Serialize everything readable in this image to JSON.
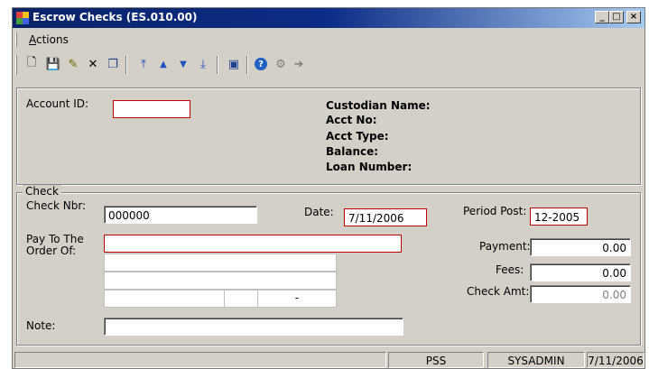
{
  "window": {
    "title": "Escrow Checks (ES.010.00)"
  },
  "menu": {
    "actions_label": "Actions"
  },
  "toolbar": {
    "buttons": [
      {
        "name": "new-icon",
        "glyph": "🗋"
      },
      {
        "name": "save-icon",
        "glyph": "💾"
      },
      {
        "name": "edit-icon",
        "glyph": "✎"
      },
      {
        "name": "delete-icon",
        "glyph": "✕"
      },
      {
        "name": "copy-icon",
        "glyph": "❐"
      },
      {
        "name": "first-record-icon",
        "glyph": "⤒"
      },
      {
        "name": "previous-record-icon",
        "glyph": "▲"
      },
      {
        "name": "next-record-icon",
        "glyph": "▼"
      },
      {
        "name": "last-record-icon",
        "glyph": "⤓"
      },
      {
        "name": "form-icon",
        "glyph": "▣"
      },
      {
        "name": "help-icon",
        "glyph": "?"
      },
      {
        "name": "tools-icon",
        "glyph": "⚙"
      },
      {
        "name": "exit-icon",
        "glyph": "➜"
      }
    ]
  },
  "account": {
    "label": "Account ID:",
    "value": "",
    "custodian_label": "Custodian Name:",
    "acct_no_label": "Acct No:",
    "acct_type_label": "Acct Type:",
    "balance_label": "Balance:",
    "loan_number_label": "Loan Number:"
  },
  "check": {
    "group_label": "Check",
    "check_nbr_label": "Check Nbr:",
    "check_nbr_value": "000000",
    "date_label": "Date:",
    "date_value": "7/11/2006",
    "period_post_label": "Period Post:",
    "period_post_value": "12-2005",
    "pay_to_label_line1": "Pay To The",
    "pay_to_label_line2": "Order Of:",
    "pay_to_value": "",
    "address_sep": "-",
    "payment_label": "Payment:",
    "payment_value": "0.00",
    "fees_label": "Fees:",
    "fees_value": "0.00",
    "check_amt_label": "Check Amt:",
    "check_amt_value": "0.00",
    "note_label": "Note:",
    "note_value": ""
  },
  "status": {
    "pane2": "PSS",
    "pane3": "SYSADMIN",
    "pane4": "7/11/2006"
  },
  "colors": {
    "title_start": "#0a246a",
    "title_end": "#a6caf0",
    "required_border": "#c00000",
    "face": "#d4d0c8"
  }
}
